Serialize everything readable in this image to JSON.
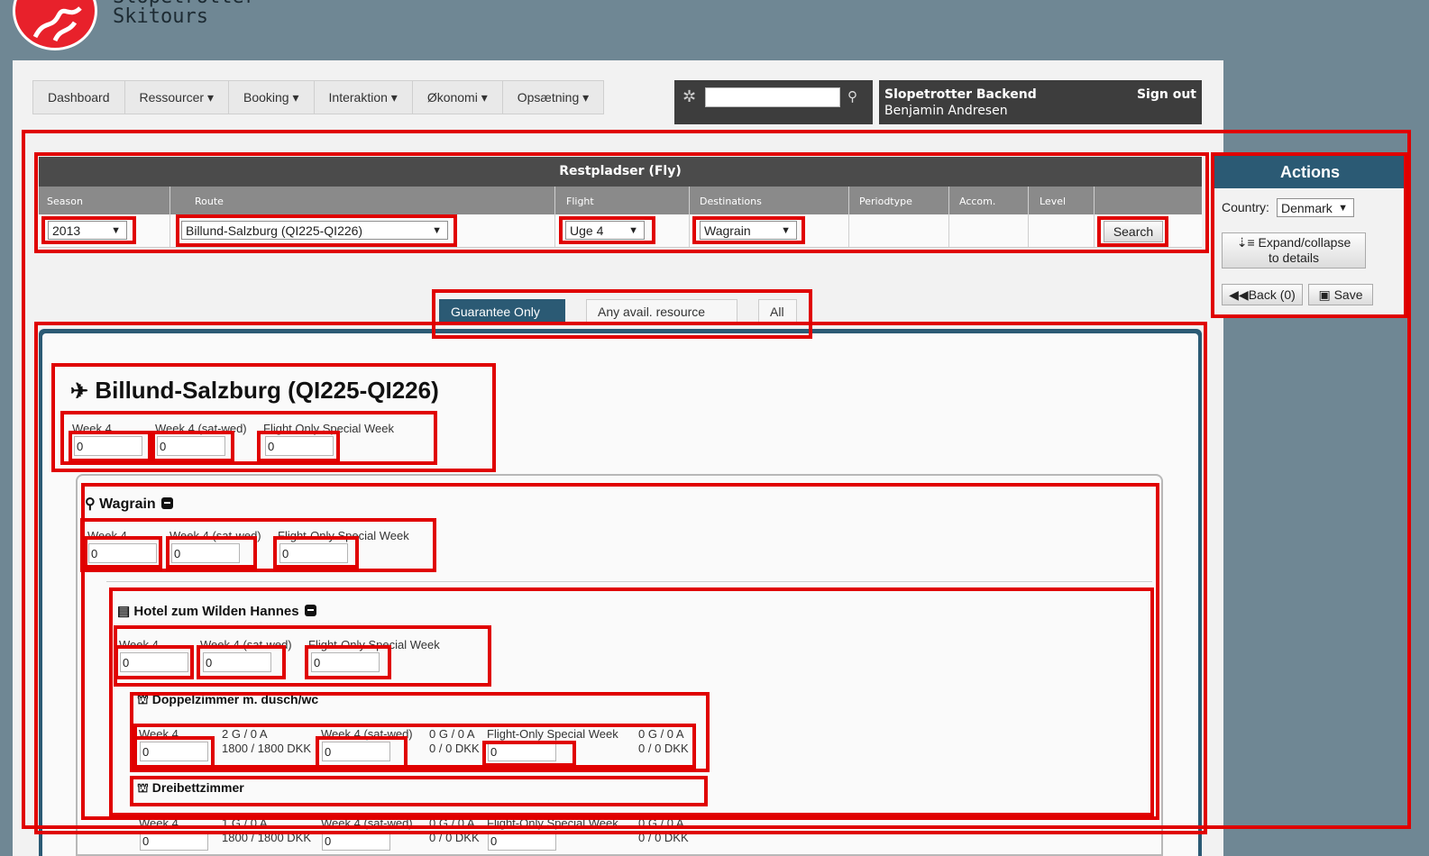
{
  "brand": {
    "line1": "Slopetrotter",
    "line2": "Skitours"
  },
  "nav": {
    "items": [
      {
        "label": "Dashboard"
      },
      {
        "label": "Ressourcer ▾"
      },
      {
        "label": "Booking ▾"
      },
      {
        "label": "Interaktion ▾"
      },
      {
        "label": "Økonomi ▾"
      },
      {
        "label": "Opsætning ▾"
      }
    ]
  },
  "search": {
    "value": ""
  },
  "user": {
    "app": "Slopetrotter Backend",
    "name": "Benjamin Andresen",
    "signout": "Sign out"
  },
  "filter": {
    "title": "Restpladser (Fly)",
    "columns": [
      "Season",
      "Route",
      "Flight",
      "Destinations",
      "Periodtype",
      "Accom.",
      "Level"
    ],
    "season": "2013",
    "route": "Billund-Salzburg (QI225-QI226)",
    "flight": "Uge 4",
    "destination": "Wagrain",
    "search_label": "Search"
  },
  "actions": {
    "title": "Actions",
    "country_label": "Country:",
    "country": "Denmark",
    "expand_line1": "Expand/collapse",
    "expand_line2": "to details",
    "back": "Back (0)",
    "save": "Save"
  },
  "tabs": [
    {
      "label": "Guarantee Only",
      "active": true
    },
    {
      "label": "Any avail. resource",
      "active": false
    },
    {
      "label": "All",
      "active": false
    }
  ],
  "route_block": {
    "title": "Billund-Salzburg (QI225-QI226)",
    "labels": [
      "Week 4",
      "Week 4 (sat-wed)",
      "Flight Only Special Week"
    ],
    "values": [
      "0",
      "0",
      "0"
    ]
  },
  "destination_block": {
    "title": "Wagrain",
    "labels": [
      "Week 4",
      "Week 4 (sat-wed)",
      "Flight-Only Special Week"
    ],
    "values": [
      "0",
      "0",
      "0"
    ]
  },
  "hotel_block": {
    "title": "Hotel zum Wilden Hannes",
    "labels": [
      "Week 4",
      "Week 4 (sat-wed)",
      "Flight-Only Special Week"
    ],
    "values": [
      "0",
      "0",
      "0"
    ]
  },
  "room1": {
    "title": "Doppelzimmer m. dusch/wc",
    "labels": [
      "Week 4",
      "Week 4 (sat-wed)",
      "Flight-Only Special Week"
    ],
    "values": [
      "0",
      "0",
      "0"
    ],
    "stats": [
      {
        "g": "2 G / 0 A",
        "p": "1800 / 1800 DKK"
      },
      {
        "g": "0 G / 0 A",
        "p": "0 / 0 DKK"
      },
      {
        "g": "0 G / 0 A",
        "p": "0 / 0 DKK"
      }
    ]
  },
  "room2": {
    "title": "Dreibettzimmer",
    "labels": [
      "Week 4",
      "Week 4 (sat-wed)",
      "Flight-Only Special Week"
    ],
    "values": [
      "0",
      "0",
      "0"
    ],
    "stats": [
      {
        "g": "1 G / 0 A",
        "p": "1800 / 1800 DKK"
      },
      {
        "g": "0 G / 0 A",
        "p": "0 / 0 DKK"
      },
      {
        "g": "0 G / 0 A",
        "p": "0 / 0 DKK"
      }
    ]
  }
}
